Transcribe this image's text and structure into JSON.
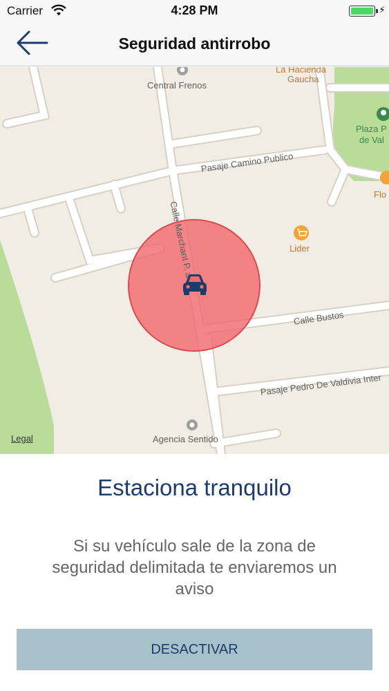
{
  "status_bar": {
    "carrier": "Carrier",
    "time": "4:28 PM"
  },
  "nav": {
    "title": "Seguridad antirrobo"
  },
  "map": {
    "places": {
      "central_frenos": "Central Frenos",
      "la_hacienda_1": "La Hacienda",
      "la_hacienda_2": "Gaucha",
      "plaza_1": "Plaza P",
      "plaza_2": "de Val",
      "flo": "Flo",
      "lider": "Lider",
      "agencia_sentido": "Agencia Sentido"
    },
    "streets": {
      "pasaje_camino_publico": "Pasaje Camino Publico",
      "calle_marchant": "Calle Marchant P. a",
      "calle_bustos": "Calle Bustos",
      "pasaje_pedro": "Pasaje Pedro De Valdivia Inter"
    },
    "legal": "Legal",
    "zone_color": "#f26a6e",
    "car_color": "#1d3b6b"
  },
  "content": {
    "headline": "Estaciona tranquilo",
    "description": "Si su vehículo sale de la zona de seguridad delimitada te enviaremos un aviso",
    "button": "DESACTIVAR"
  }
}
